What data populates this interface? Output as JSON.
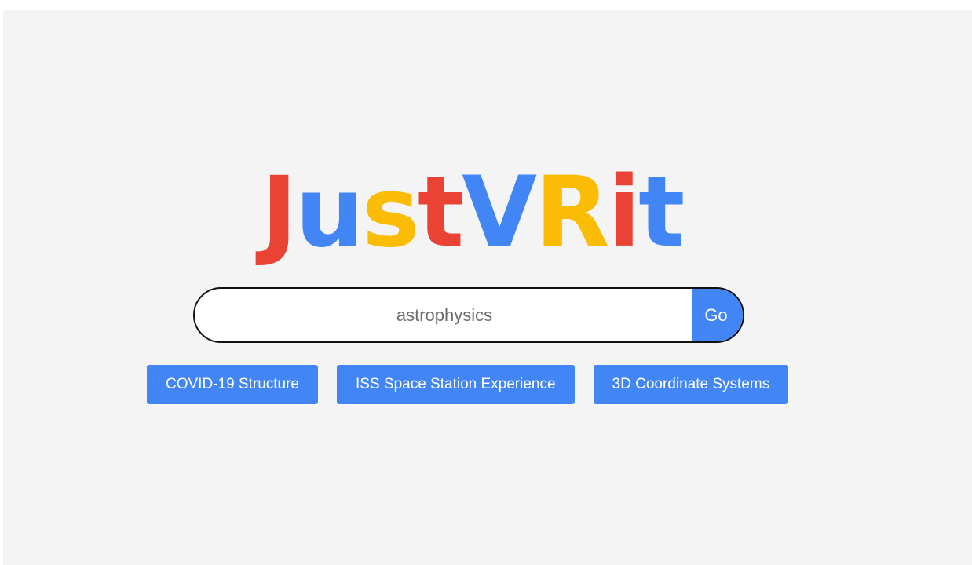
{
  "logo": {
    "letters": [
      {
        "char": "J",
        "color": "#ea4335"
      },
      {
        "char": "u",
        "color": "#4285f4"
      },
      {
        "char": "s",
        "color": "#fbbc05"
      },
      {
        "char": "t",
        "color": "#ea4335"
      },
      {
        "char": "V",
        "color": "#4285f4"
      },
      {
        "char": "R",
        "color": "#fbbc05"
      },
      {
        "char": "i",
        "color": "#ea4335"
      },
      {
        "char": "t",
        "color": "#4285f4"
      }
    ]
  },
  "search": {
    "value": "astrophysics",
    "button_label": "Go"
  },
  "suggestions": [
    {
      "label": "COVID-19 Structure"
    },
    {
      "label": "ISS Space Station Experience"
    },
    {
      "label": "3D Coordinate Systems"
    }
  ],
  "colors": {
    "accent": "#4285f4",
    "background": "#f4f4f4"
  }
}
